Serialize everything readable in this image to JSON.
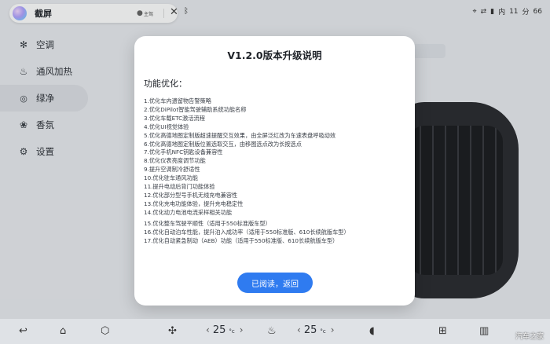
{
  "status_bar": {
    "voice_title": "截屏",
    "voice_mode": "主驾",
    "indicator_text": "内",
    "temperature": "11",
    "temperature_unit": "分",
    "battery": "66"
  },
  "sidebar": {
    "items": [
      {
        "label": "空调",
        "icon": "gear-icon"
      },
      {
        "label": "通风加热",
        "icon": "seat-icon"
      },
      {
        "label": "绿净",
        "icon": "leaf-icon",
        "active": true
      },
      {
        "label": "香氛",
        "icon": "fragrance-icon"
      },
      {
        "label": "设置",
        "icon": "settings-icon"
      }
    ]
  },
  "dialog": {
    "title": "V1.2.0版本升级说明",
    "subtitle": "功能优化：",
    "notes": [
      "1.优化车内遗留物告警策略",
      "2.优化DiPilot智能驾驶辅助系统功能名称",
      "3.优化车载ETC激活流程",
      "4.优化UI视觉体验",
      "5.优化高德地图定制版超速提醒交互效果，由全屏泛红改为车速表盘呼吸动效",
      "6.优化高德地图定制版位置选取交互，由移图选点改为长按选点",
      "7.优化手机NFC钥匙设备兼容性",
      "8.优化仪表亮度调节功能",
      "9.提升空调制冷舒适性",
      "10.优化驻车通风功能",
      "11.提升电动后背门功能体验",
      "12.优化部分型号手机无线充电兼容性",
      "13.优化充电功能体验，提升充电稳定性",
      "14.优化动力电池电流采样相关功能",
      "15.优化整车驾驶平顺性（适用于550标准版车型）",
      "16.优化自动泊车性能，提升泊入成功率（适用于550标准版、610长续航版车型）",
      "17.优化自动紧急制动（AEB）功能（适用于550标准版、610长续航版车型）"
    ],
    "confirm_label": "已阅读，返回"
  },
  "dock": {
    "left_temp": "25",
    "right_temp": "25",
    "temp_unit": "°c",
    "watermark": "汽车之家"
  }
}
